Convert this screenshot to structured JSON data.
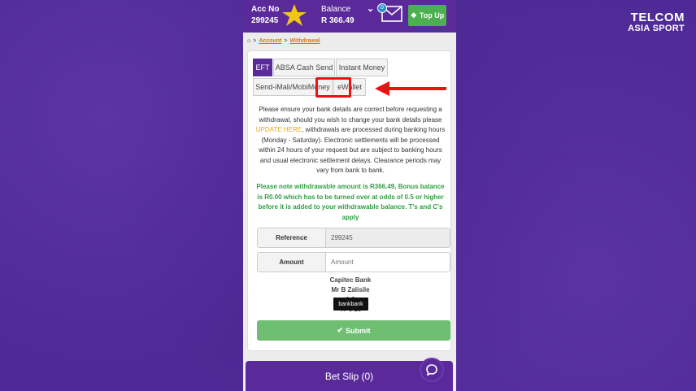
{
  "watermark": {
    "top": "TELCOM",
    "bottom": "ASIA SPORT"
  },
  "header": {
    "acc_label": "Acc No",
    "acc_number": "299245",
    "balance_label": "Balance",
    "balance_value": "R 366.49",
    "mail_count": "0",
    "topup_label": "Top Up"
  },
  "breadcrumb": {
    "account": "Account",
    "sep": ">",
    "withdrawal": "Withdrawal"
  },
  "tabs": [
    "EFT",
    "ABSA Cash Send",
    "Instant Money",
    "Send-iMali/MobiMoney",
    "eWallet"
  ],
  "notice": {
    "part1": "Please ensure your bank details are correct before requesting a withdrawal, should you wish to change your bank details please ",
    "link": "UPDATE HERE",
    "part2": ", withdrawals are processed during banking hours (Monday - Saturday). Electronic settlements will be processed within 24 hours of your request but are subject to banking hours and usual electronic settlement delays. Clearance periods may vary from bank to bank."
  },
  "note_green": "Please note withdrawable amount is R366.49, Bonus balance is R0.00 which has to be turned over at odds of 0.5 or higher before it is added to your withdrawable balance. T's and C's apply",
  "form": {
    "reference_label": "Reference",
    "reference_value": "299245",
    "amount_label": "Amount",
    "amount_placeholder": "Amount"
  },
  "bank": {
    "line1": "Capitec Bank",
    "line2": "Mr B Zalisile",
    "line3": "1          6",
    "line4": "47 0 10"
  },
  "tooltip": "bankbank",
  "submit_label": "Submit",
  "betslip_label": "Bet Slip (0)",
  "colors": {
    "brand": "#5a2a9a",
    "accent_green": "#4caf50",
    "link_orange": "#d9780a",
    "highlight_red": "#e11111"
  }
}
